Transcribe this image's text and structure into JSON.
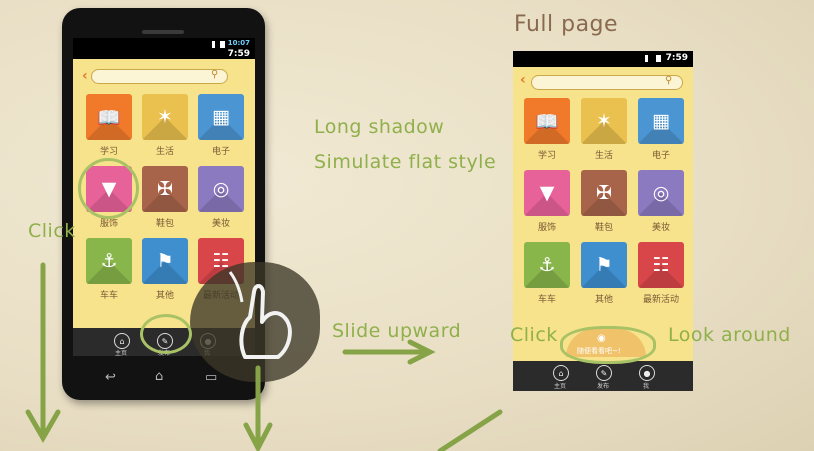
{
  "annotations": {
    "full_page": "Full page",
    "long_shadow": "Long shadow",
    "simulate_flat": "Simulate flat style",
    "click_left": "Click",
    "slide_upward": "Slide upward",
    "click_right": "Click",
    "look_around": "Look around"
  },
  "phone_left": {
    "status_time": "7:59",
    "status_time_top": "10:07"
  },
  "phone_right": {
    "status_time": "7:59",
    "pull_hint": "随便看看吧~!"
  },
  "categories": [
    {
      "label": "学习",
      "color": "#f07a2a",
      "icon": "book-icon"
    },
    {
      "label": "生活",
      "color": "#eac04e",
      "icon": "lamp-icon"
    },
    {
      "label": "电子",
      "color": "#4b95d2",
      "icon": "calculator-icon"
    },
    {
      "label": "服饰",
      "color": "#e8629a",
      "icon": "shirt-icon"
    },
    {
      "label": "鞋包",
      "color": "#a8644a",
      "icon": "heel-icon"
    },
    {
      "label": "美妆",
      "color": "#8c7ac0",
      "icon": "mirror-icon"
    },
    {
      "label": "车车",
      "color": "#88b64a",
      "icon": "bike-icon"
    },
    {
      "label": "其他",
      "color": "#3f8fcf",
      "icon": "flag-icon"
    },
    {
      "label": "最新活动",
      "color": "#d9464a",
      "icon": "news-icon"
    }
  ],
  "nav": {
    "home": "主页",
    "publish": "发布",
    "me": "我"
  },
  "colors": {
    "annotation_green": "#8fb04a",
    "app_background": "#f7e38c",
    "heading_brown": "#8a6a4e"
  }
}
